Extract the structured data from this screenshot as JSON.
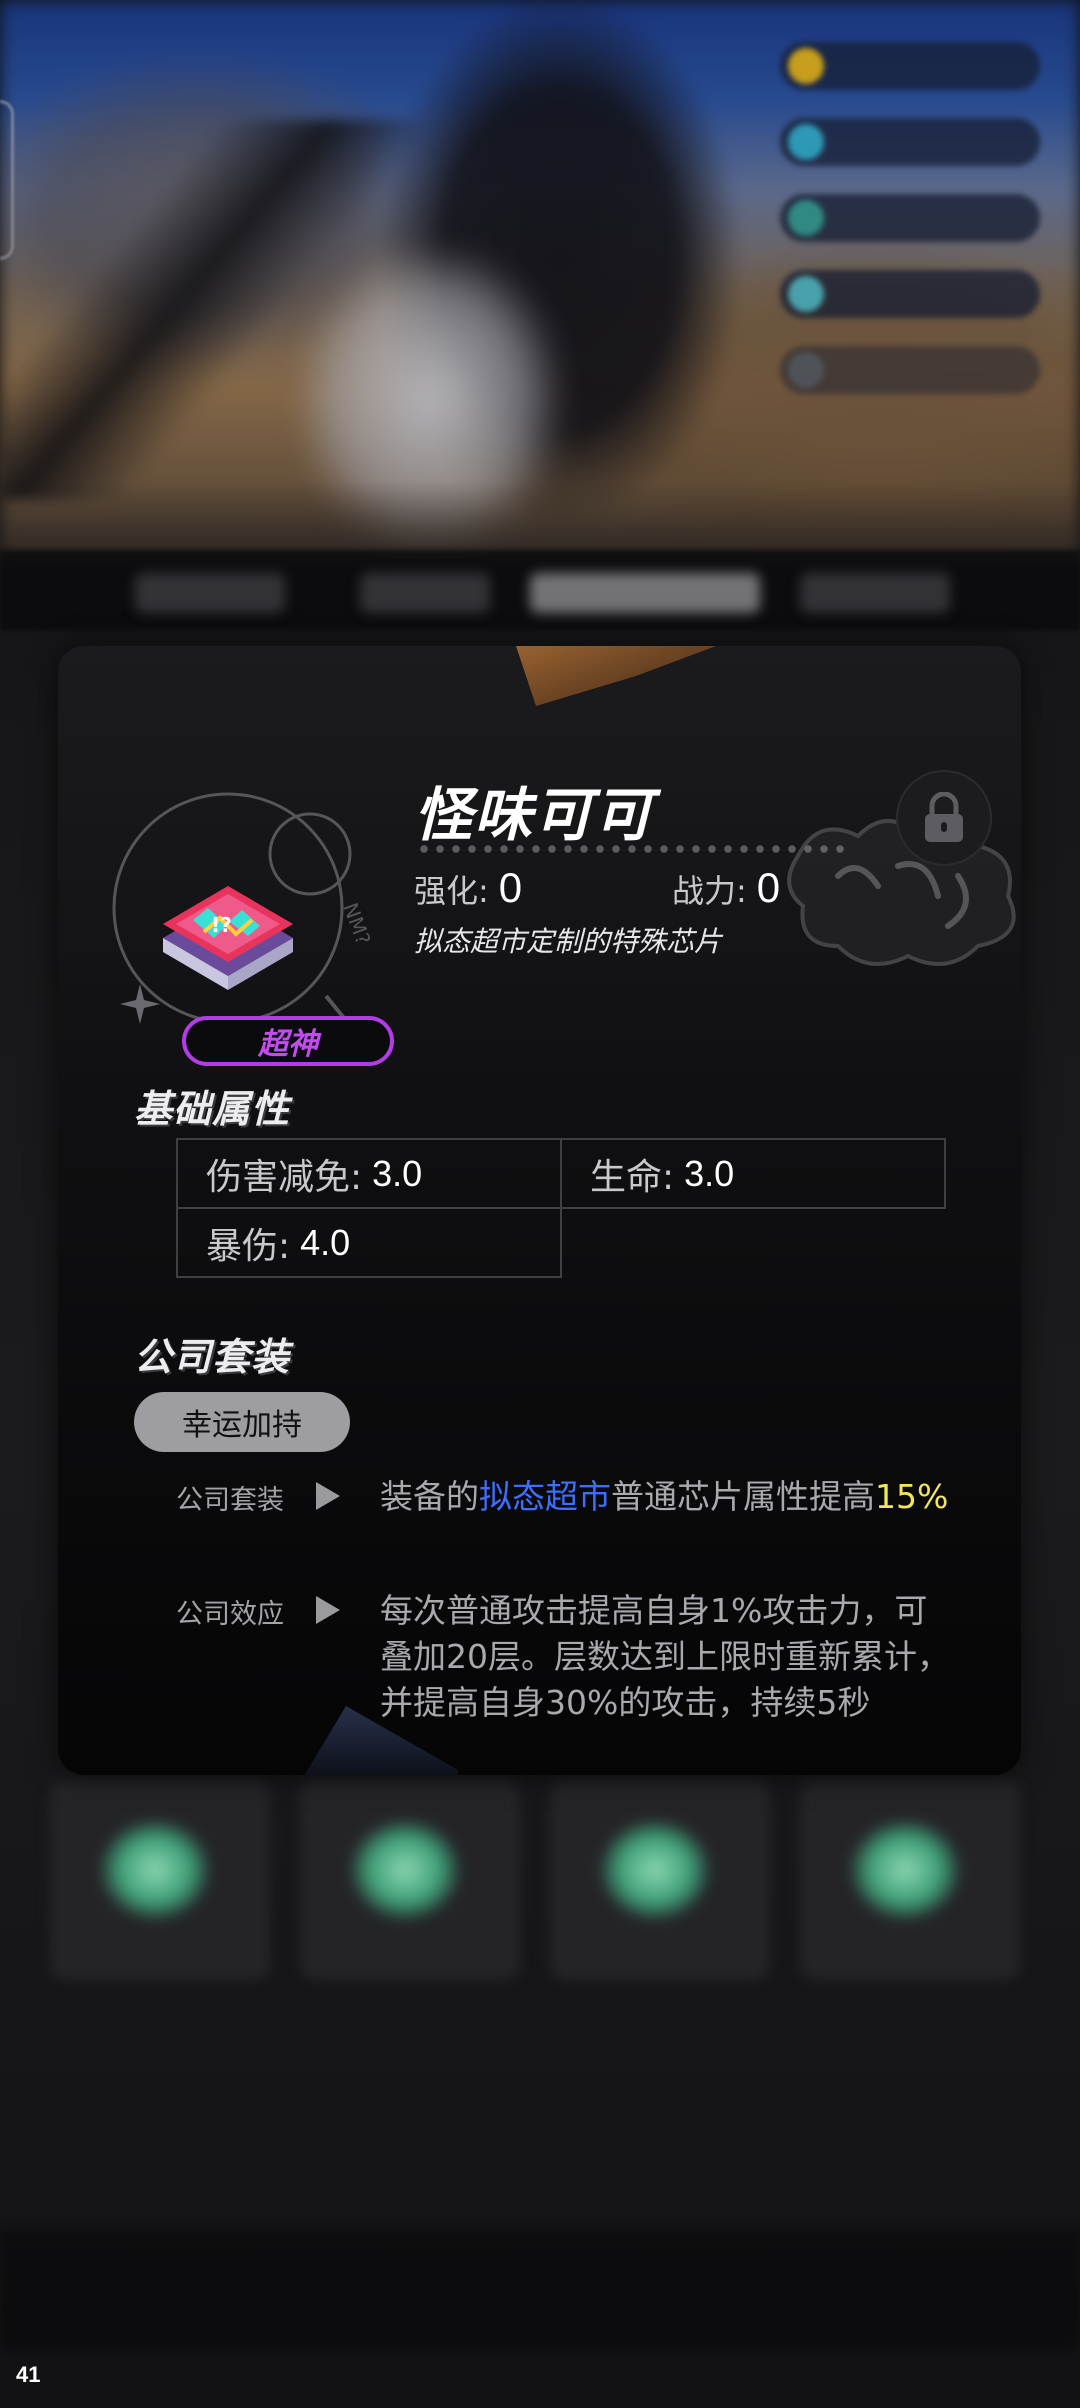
{
  "chip": {
    "name": "怪味可可",
    "enhance_label": "强化:",
    "enhance_value": "0",
    "power_label": "战力:",
    "power_value": "0",
    "description": "拟态超市定制的特殊芯片",
    "rarity": "超神",
    "rarity_color": "#b43be8"
  },
  "base_attributes": {
    "heading": "基础属性",
    "items": [
      {
        "label": "伤害减免:",
        "value": "3.0"
      },
      {
        "label": "生命:",
        "value": "3.0"
      },
      {
        "label": "暴伤:",
        "value": "4.0"
      }
    ]
  },
  "company_set": {
    "heading": "公司套装",
    "set_name": "幸运加持",
    "set_bonus": {
      "label": "公司套装",
      "text_before": "装备的",
      "company_name": "拟态超市",
      "text_middle": "普通芯片属性提高",
      "percent": "15%",
      "highlight_blue": "#3f6dff",
      "highlight_yellow": "#f2e65a"
    },
    "company_effect": {
      "label": "公司效应",
      "text": "每次普通攻击提高自身1%攻击力，可叠加20层。层数达到上限时重新累计，并提高自身30%的攻击，持续5秒"
    }
  },
  "footer": {
    "page_number": "41"
  },
  "icons": {
    "lock": "lock-icon",
    "arrow": "play-arrow-icon"
  }
}
